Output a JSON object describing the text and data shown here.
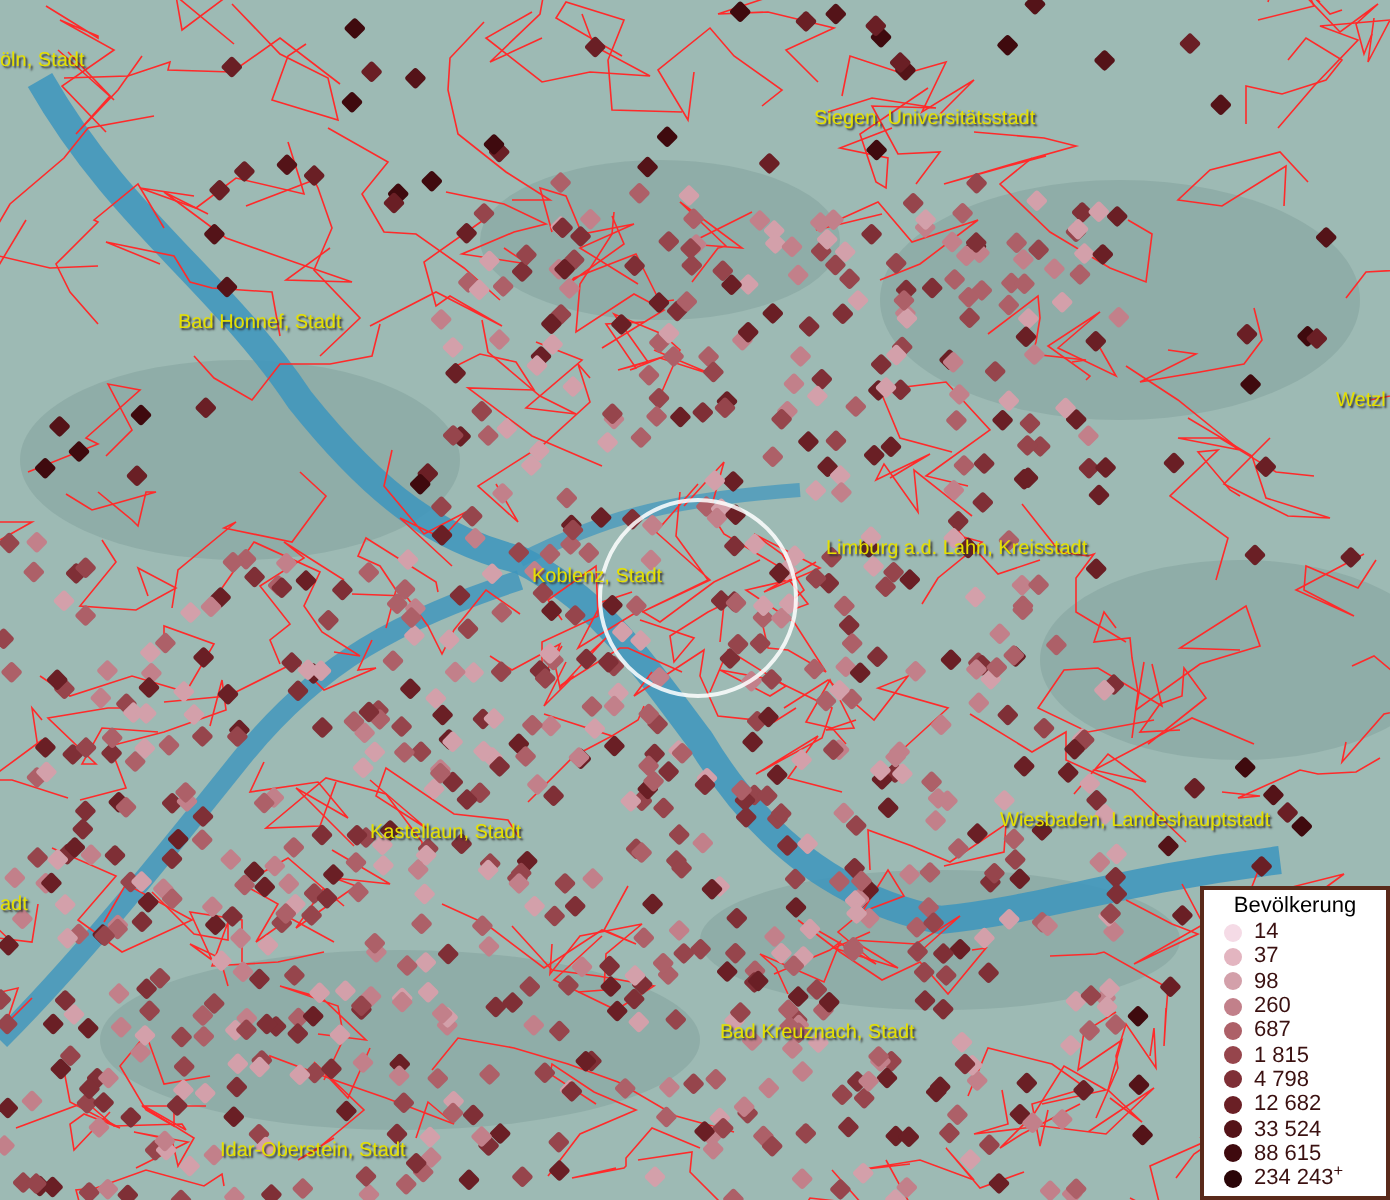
{
  "map": {
    "place_labels": [
      "öln, Stadt",
      "Siegen, Universitätsstadt",
      "Bad Honnef, Stadt",
      "Wetzl",
      "Limburg a.d. Lahn, Kreisstadt",
      "Koblenz, Stadt",
      "Wiesbaden, Landeshauptstadt",
      "Kastellaun, Stadt",
      "adt",
      "Bad Kreuznach, Stadt",
      "Idar-Oberstein, Stadt"
    ]
  },
  "legend": {
    "title": "Bevölkerung",
    "items": [
      {
        "label": "14",
        "color": "#f5dbe6"
      },
      {
        "label": "37",
        "color": "#e3b5c0"
      },
      {
        "label": "98",
        "color": "#d3a0aa"
      },
      {
        "label": "260",
        "color": "#c2808a"
      },
      {
        "label": "687",
        "color": "#ad6068"
      },
      {
        "label": "1 815",
        "color": "#96454c"
      },
      {
        "label": "4 798",
        "color": "#7f2f36"
      },
      {
        "label": "12 682",
        "color": "#6a1f25"
      },
      {
        "label": "33 524",
        "color": "#541318"
      },
      {
        "label": "88 615",
        "color": "#3f0a0e"
      },
      {
        "label": "234 243$^{+}$",
        "color": "#2a0507"
      }
    ]
  }
}
